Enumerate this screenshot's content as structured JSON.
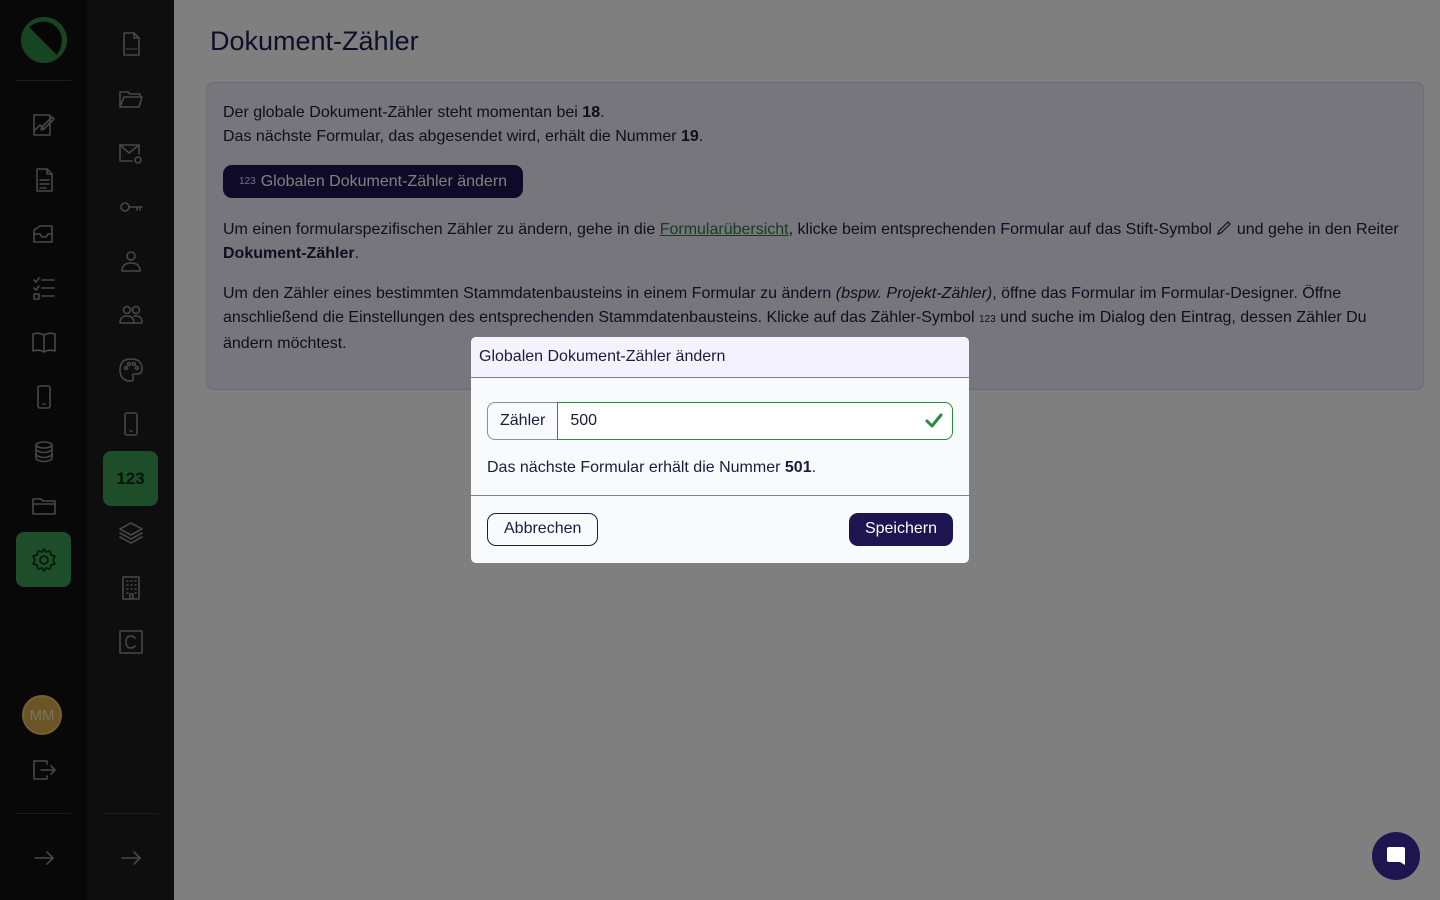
{
  "user": {
    "initials": "MM"
  },
  "page": {
    "title": "Dokument-Zähler"
  },
  "info": {
    "line1_pre": "Der globale Dokument-Zähler steht momentan bei ",
    "current_value": "18",
    "line1_post": ".",
    "line2_pre": "Das nächste Formular, das abgesendet wird, erhält die Nummer ",
    "next_value": "19",
    "line2_post": ".",
    "button_icon_text": "123",
    "button_label": "Globalen Dokument-Zähler ändern",
    "p2_pre": "Um einen formularspezifischen Zähler zu ändern, gehe in die ",
    "p2_link": "Formularübersicht",
    "p2_mid": ", klicke beim entsprechenden Formular auf das Stift-Symbol ",
    "p2_after_icon": " und gehe in den Reiter ",
    "p2_bold": "Dokument-Zähler",
    "p2_post": ".",
    "p3_pre": "Um den Zähler eines bestimmten Stammdatenbausteins in einem Formular zu ändern ",
    "p3_italic": "(bspw. Projekt-Zähler)",
    "p3_mid": ", öffne das Formular im Formular-Designer. Öffne anschließend die Einstellungen des entsprechenden Stammdatenbausteins. Klicke auf das Zähler-Symbol ",
    "p3_icon_text": "123",
    "p3_post": " und suche im Dialog den Eintrag, dessen Zähler Du ändern möchtest."
  },
  "secondary_nav": {
    "active_label": "123"
  },
  "modal": {
    "title": "Globalen Dokument-Zähler ändern",
    "field_label": "Zähler",
    "field_value": "500",
    "hint_pre": "Das nächste Formular erhält die Nummer ",
    "hint_value": "501",
    "hint_post": ".",
    "cancel_label": "Abbrechen",
    "save_label": "Speichern"
  },
  "colors": {
    "accent_green": "#3a9c53",
    "primary_navy": "#1d1450",
    "link_green": "#2c7a3d"
  }
}
